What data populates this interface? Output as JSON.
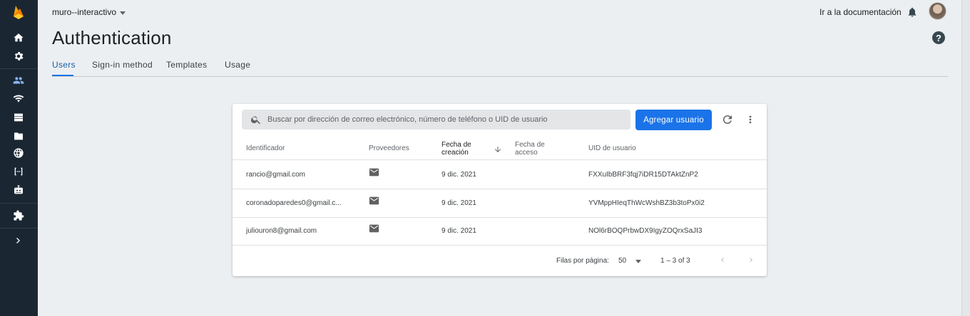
{
  "header": {
    "project_name": "muro--interactivo",
    "docs_link": "Ir a la documentación",
    "page_title": "Authentication",
    "help_label": "?"
  },
  "rail": {
    "icons": [
      "firebase-logo",
      "home-icon",
      "settings-icon",
      "users-icon",
      "realtime-icon",
      "database-icon",
      "storage-icon",
      "hosting-icon",
      "functions-icon",
      "ml-icon",
      "extensions-icon",
      "expand-icon"
    ],
    "accent": "#8ab4f8",
    "background": "#1a2733"
  },
  "tabs": [
    {
      "label": "Users",
      "active": true
    },
    {
      "label": "Sign-in method",
      "active": false
    },
    {
      "label": "Templates",
      "active": false
    },
    {
      "label": "Usage",
      "active": false
    }
  ],
  "toolbar": {
    "search_placeholder": "Buscar por dirección de correo electrónico, número de teléfono o UID de usuario",
    "add_user_label": "Agregar usuario",
    "primary_color": "#1a73e8"
  },
  "table": {
    "columns": [
      {
        "label_line1": "Identificador",
        "label_line2": ""
      },
      {
        "label_line1": "Proveedores",
        "label_line2": ""
      },
      {
        "label_line1": "Fecha de",
        "label_line2": "creación"
      },
      {
        "label_line1": "Fecha de",
        "label_line2": "acceso"
      },
      {
        "label_line1": "UID de usuario",
        "label_line2": ""
      }
    ],
    "rows": [
      {
        "identifier": "rancio@gmail.com",
        "provider": "mail-icon",
        "created": "9 dic. 2021",
        "signed_in": "",
        "uid": "FXXuIbBRF3fqj7iDR15DTAktZnP2"
      },
      {
        "identifier": "coronadoparedes0@gmail.c...",
        "provider": "mail-icon",
        "created": "9 dic. 2021",
        "signed_in": "",
        "uid": "YVMppHIeqThWcWshBZ3b3toPx0i2"
      },
      {
        "identifier": "juliouron8@gmail.com",
        "provider": "mail-icon",
        "created": "9 dic. 2021",
        "signed_in": "",
        "uid": "NOl6rBOQPrbwDX9IgyZOQrxSaJI3"
      }
    ]
  },
  "pagination": {
    "rows_per_page_label": "Filas por página:",
    "rows_per_page_value": "50",
    "range_text": "1 – 3 of 3"
  }
}
